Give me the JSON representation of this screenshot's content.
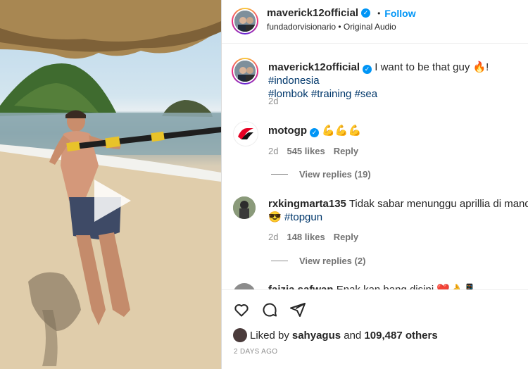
{
  "media": {
    "play_icon": "play-icon"
  },
  "header": {
    "username": "maverick12official",
    "verified_icon": "verified-badge-icon",
    "separator": "•",
    "follow_label": "Follow",
    "subtitle": "fundadorvisionario • Original Audio"
  },
  "caption": {
    "username": "maverick12official",
    "text_before": "I want to be that guy 🔥!",
    "tags_line1": "#indonesia",
    "tags_line2": "#lombok #training #sea",
    "age": "2d"
  },
  "comments": [
    {
      "username": "motogp",
      "text": "💪💪💪",
      "age": "2d",
      "likes": "545 likes",
      "reply": "Reply",
      "view_replies": "View replies (19)"
    },
    {
      "username": "rxkingmarta135",
      "text": "Tidak sabar menunggu aprillia di mandalika",
      "text2_emoji": "😎",
      "text2_tag": "#topgun",
      "age": "2d",
      "likes": "148 likes",
      "reply": "Reply",
      "view_replies": "View replies (2)"
    },
    {
      "username": "faizia.safwan",
      "text": "Enak kan bang disini ❤️👌📱"
    }
  ],
  "actions": {
    "like_icon": "heart-icon",
    "comment_icon": "comment-icon",
    "share_icon": "share-icon"
  },
  "likes": {
    "prefix": "Liked by ",
    "user": "sahyagus",
    "middle": " and ",
    "count": "109,487 others"
  },
  "time_ago": "2 DAYS AGO",
  "colors": {
    "accent": "#0095f6",
    "tag": "#00376b",
    "muted": "#8e8e8e"
  }
}
